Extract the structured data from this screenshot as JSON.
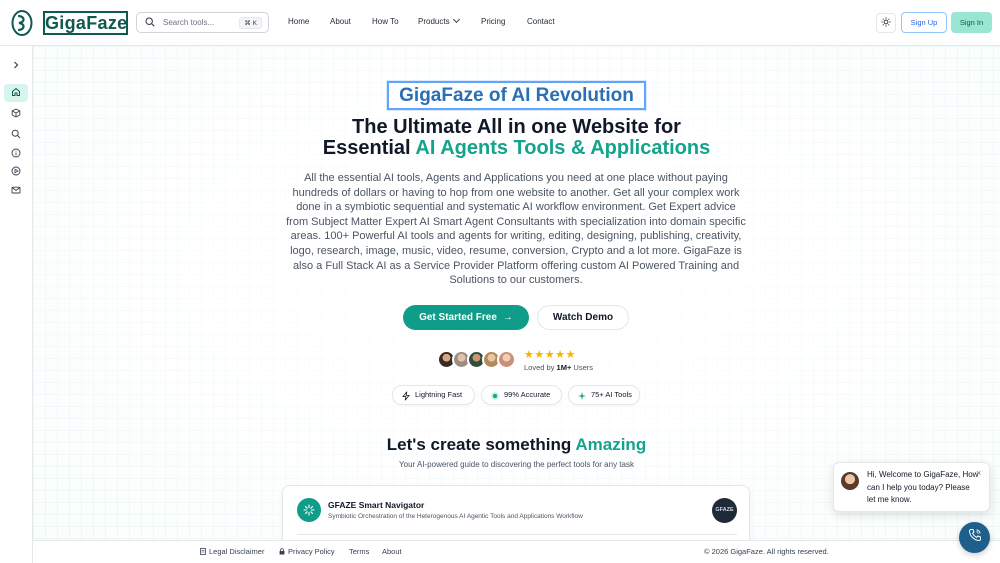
{
  "brand": {
    "name": "GigaFaze"
  },
  "header": {
    "search_placeholder": "Search tools...",
    "search_shortcut": "⌘ K",
    "nav": {
      "home": "Home",
      "about": "About",
      "howto": "How To",
      "products": "Products",
      "pricing": "Pricing",
      "contact": "Contact"
    },
    "sign_up": "Sign Up",
    "sign_in": "Sign In"
  },
  "sidebar": {
    "items": [
      "expand-icon",
      "home-icon",
      "cube-icon",
      "search-icon",
      "info-icon",
      "play-icon",
      "mail-icon"
    ],
    "active": "home-icon"
  },
  "hero": {
    "badge": "GigaFaze of AI Revolution",
    "title_line1": "The Ultimate All in one Website for",
    "title_line2_plain": "Essential ",
    "title_line2_highlight": "AI Agents Tools & Applications",
    "description": "All the essential AI tools, Agents and Applications you need at one place without paying hundreds of dollars or having to hop from one website to another. Get all your complex work done in a symbiotic sequential and systematic AI workflow environment. Get Expert advice from Subject Matter Expert AI Smart Agent Consultants with specialization into domain specific areas. 100+ Powerful AI tools and agents for writing, editing, designing, publishing, creativity, logo, research, image, music, video, resume, conversion, Crypto and a lot more. GigaFaze is also a Full Stack AI as a Service Provider Platform offering custom AI Powered Training and Solutions to our customers.",
    "cta_primary": "Get Started Free",
    "cta_secondary": "Watch Demo",
    "stars": "★★★★★",
    "loved_prefix": "Loved by ",
    "loved_count": "1M+",
    "loved_suffix": " Users",
    "pills": [
      "Lightning Fast",
      "99% Accurate",
      "75+ AI Tools"
    ]
  },
  "section": {
    "title_plain": "Let's create something ",
    "title_highlight": "Amazing",
    "subtitle": "Your AI-powered guide to discovering the perfect tools for any task"
  },
  "navigator": {
    "title": "GFAZE Smart Navigator",
    "subtitle": "Symbiotic Orchestration of the Heterogenous AI Agentic Tools and Applications Workflow",
    "logo_text": "GFAZE"
  },
  "footer": {
    "legal": "Legal Disclaimer",
    "privacy": "Privacy Policy",
    "terms": "Terms",
    "about": "About",
    "copyright": "© 2026 GigaFaze. All rights reserved."
  },
  "chat": {
    "message": "Hi, Welcome to GigaFaze, How can I help you today? Please let me know.",
    "close": "×"
  },
  "colors": {
    "brand_dark": "#0f5a4e",
    "accent": "#14a38b",
    "button": "#0f9d8a",
    "badge_blue": "#2a6fb5",
    "star": "#f5b301",
    "chat_fab": "#1e5f8c"
  }
}
